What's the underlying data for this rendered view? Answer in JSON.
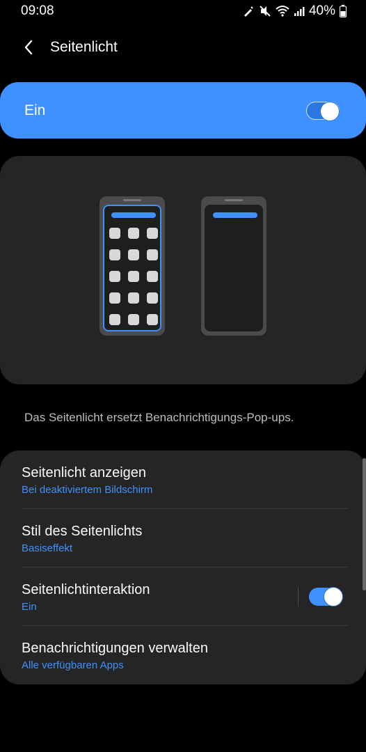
{
  "status": {
    "time": "09:08",
    "battery": "40%"
  },
  "header": {
    "title": "Seitenlicht",
    "back_icon": "chevron-left-icon"
  },
  "master_switch": {
    "label": "Ein",
    "on": true
  },
  "description": "Das Seitenlicht ersetzt Benachrichtigungs-Pop-ups.",
  "settings": [
    {
      "title": "Seitenlicht anzeigen",
      "subtitle": "Bei deaktiviertem Bildschirm"
    },
    {
      "title": "Stil des Seitenlichts",
      "subtitle": "Basiseffekt"
    },
    {
      "title": "Seitenlichtinteraktion",
      "subtitle": "Ein",
      "toggle_on": true
    },
    {
      "title": "Benachrichtigungen verwalten",
      "subtitle": "Alle verfügbaren Apps"
    }
  ],
  "colors": {
    "accent": "#3e91ff",
    "card": "#252525",
    "background": "#000000"
  }
}
